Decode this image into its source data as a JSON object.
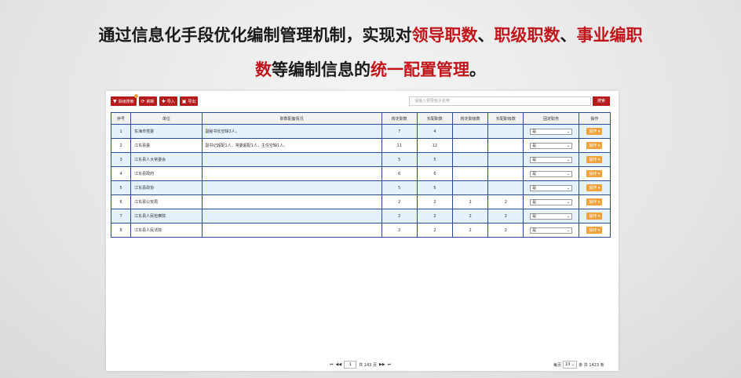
{
  "headline": {
    "line1": [
      {
        "text": "通过信息化手段优化编制管理机制，实现对",
        "red": false
      },
      {
        "text": "领导职数",
        "red": true
      },
      {
        "text": "、",
        "red": false
      },
      {
        "text": "职级职数",
        "red": true
      },
      {
        "text": "、",
        "red": false
      },
      {
        "text": "事业编职",
        "red": true
      }
    ],
    "line2": [
      {
        "text": "数",
        "red": true
      },
      {
        "text": "等编制信息的",
        "red": false
      },
      {
        "text": "统一配置管理",
        "red": true
      },
      {
        "text": "。",
        "red": false
      }
    ]
  },
  "toolbar": {
    "advanced_search": "高级搜索",
    "refresh": "刷新",
    "import": "导入",
    "export": "导出"
  },
  "search": {
    "placeholder": "请输入领导班子名称",
    "button": "搜索"
  },
  "table": {
    "headers": [
      "序号",
      "单位",
      "职数配备情况",
      "核定职数",
      "实配职数",
      "核定职级数",
      "实配职级数",
      "固定职务",
      "操作"
    ],
    "rows": [
      {
        "no": "1",
        "unit": "东海市党委",
        "status": "副秘书长空缺3人。",
        "approved": "7",
        "actual": "4",
        "approved_rank": "",
        "actual_rank": "",
        "fixed": "是",
        "op": "操作"
      },
      {
        "no": "2",
        "unit": "江东县委",
        "status": "副书记超配1人，常委超配1人，主任空缺1人。",
        "approved": "11",
        "actual": "12",
        "approved_rank": "",
        "actual_rank": "",
        "fixed": "是",
        "op": "操作"
      },
      {
        "no": "3",
        "unit": "江东县人大常委会",
        "status": "",
        "approved": "5",
        "actual": "5",
        "approved_rank": "",
        "actual_rank": "",
        "fixed": "是",
        "op": "操作"
      },
      {
        "no": "4",
        "unit": "江东县政府",
        "status": "",
        "approved": "6",
        "actual": "6",
        "approved_rank": "",
        "actual_rank": "",
        "fixed": "是",
        "op": "操作"
      },
      {
        "no": "5",
        "unit": "江东县政协",
        "status": "",
        "approved": "5",
        "actual": "5",
        "approved_rank": "",
        "actual_rank": "",
        "fixed": "是",
        "op": "操作"
      },
      {
        "no": "6",
        "unit": "江东县公安局",
        "status": "",
        "approved": "2",
        "actual": "2",
        "approved_rank": "2",
        "actual_rank": "2",
        "fixed": "是",
        "op": "操作"
      },
      {
        "no": "7",
        "unit": "江东县人民检察院",
        "status": "",
        "approved": "2",
        "actual": "2",
        "approved_rank": "2",
        "actual_rank": "2",
        "fixed": "是",
        "op": "操作"
      },
      {
        "no": "8",
        "unit": "江东县人民法院",
        "status": "",
        "approved": "2",
        "actual": "2",
        "approved_rank": "2",
        "actual_rank": "2",
        "fixed": "是",
        "op": "操作"
      }
    ]
  },
  "pager": {
    "current": "1",
    "total_pages_text": "共 143 页",
    "per_page_label": "每页",
    "per_page_value": "10",
    "total_text": "条 共 1423 条"
  },
  "colors": {
    "accent": "#b51c1c",
    "orange": "#f0a23a",
    "row_alt": "#e5f1fc",
    "border": "#2b4a9a"
  }
}
